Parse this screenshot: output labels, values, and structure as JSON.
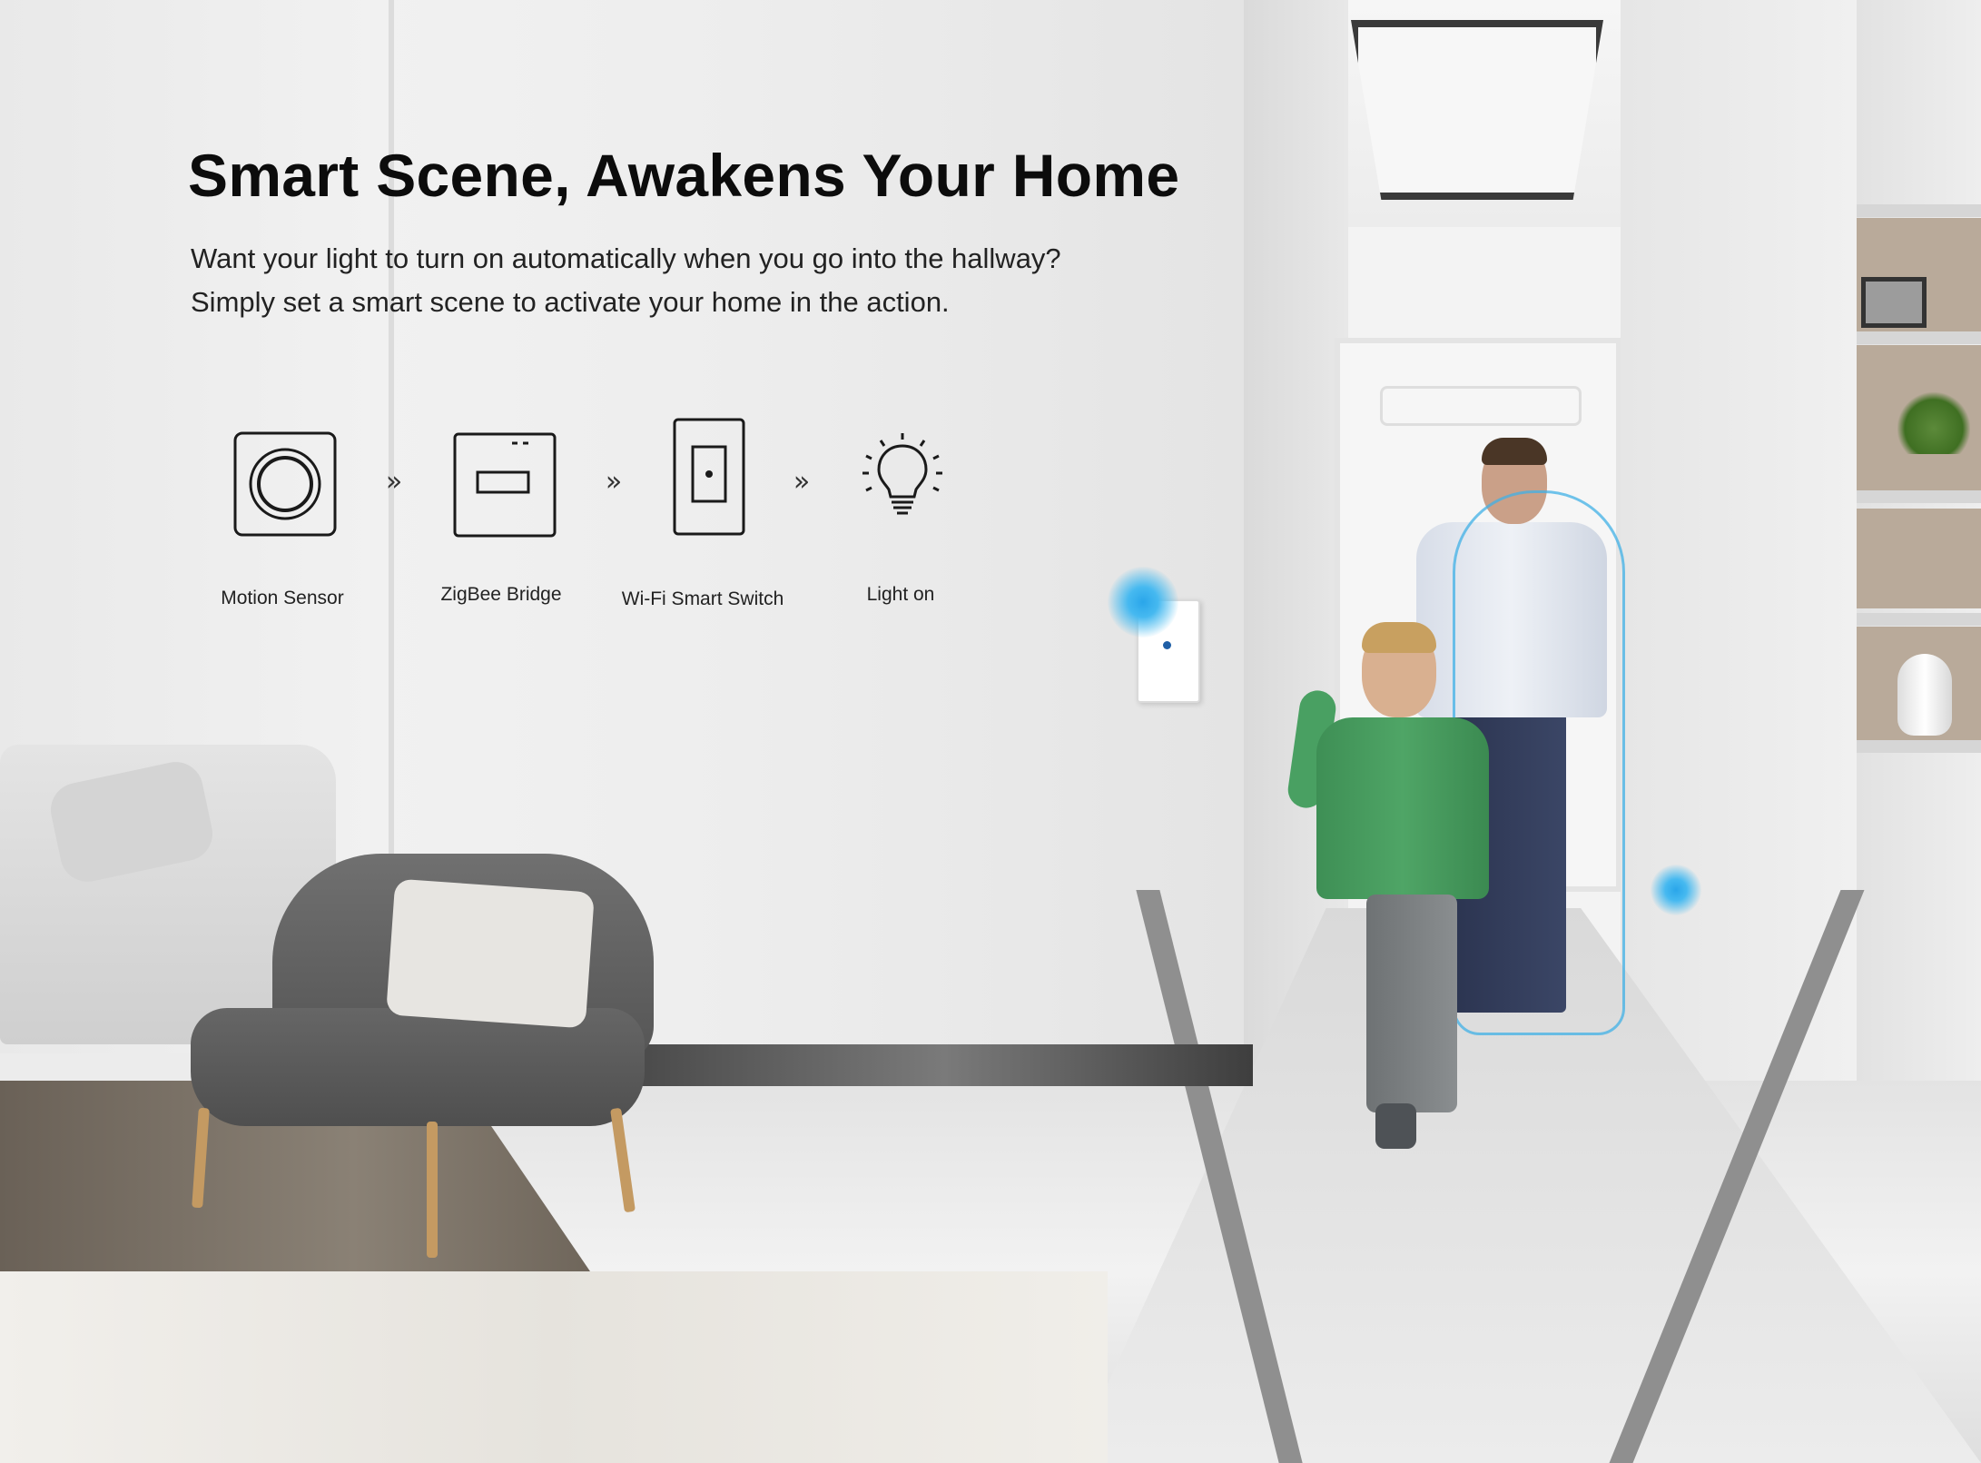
{
  "headline": {
    "title": "Smart Scene, Awakens Your Home",
    "line1": "Want your light to turn on automatically when you go into the hallway?",
    "line2": "Simply set a smart scene to activate your home in the action."
  },
  "flow": {
    "arrow": "»",
    "steps": [
      {
        "label": "Motion Sensor",
        "icon": "motion-sensor-icon"
      },
      {
        "label": "ZigBee Bridge",
        "icon": "zigbee-bridge-icon"
      },
      {
        "label": "Wi-Fi Smart Switch",
        "icon": "wifi-smart-switch-icon"
      },
      {
        "label": "Light on",
        "icon": "light-bulb-icon"
      }
    ]
  },
  "colors": {
    "title": "#0c0c0c",
    "text": "#222222",
    "signal_blue": "#2aa6ea"
  }
}
